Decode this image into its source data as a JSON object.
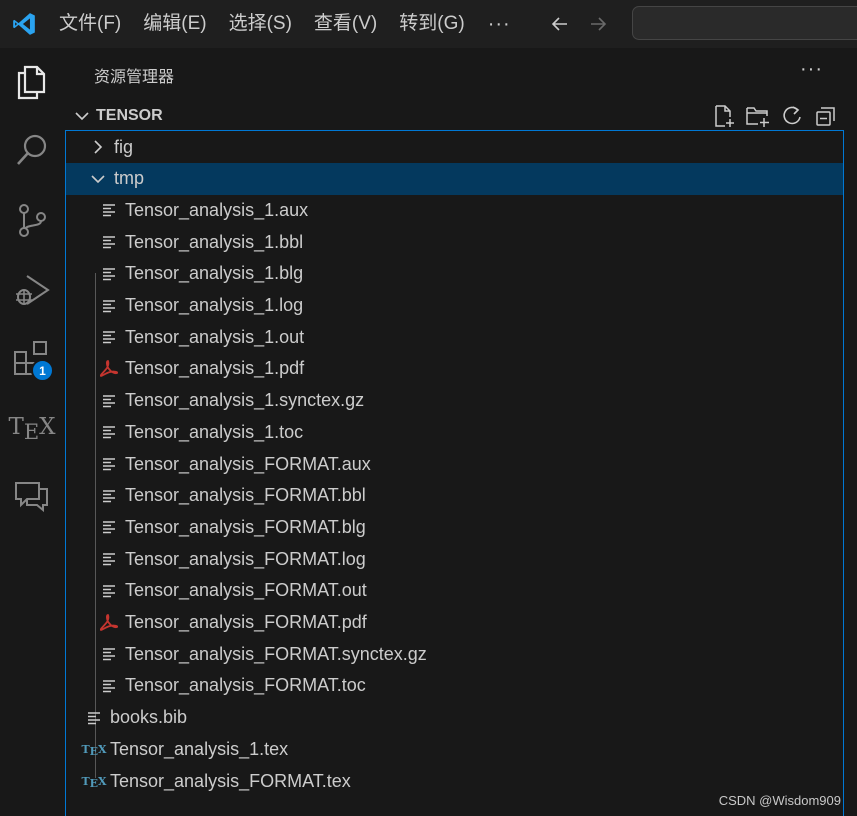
{
  "menu": {
    "items": [
      "文件(F)",
      "编辑(E)",
      "选择(S)",
      "查看(V)",
      "转到(G)"
    ],
    "more": "···"
  },
  "explorer": {
    "title": "资源管理器",
    "more": "···",
    "root": "TENSOR"
  },
  "tree": [
    {
      "name": "fig",
      "type": "folder-collapsed",
      "depth": 0
    },
    {
      "name": "tmp",
      "type": "folder-expanded",
      "depth": 0,
      "selected": true
    },
    {
      "name": "Tensor_analysis_1.aux",
      "type": "text",
      "depth": 1
    },
    {
      "name": "Tensor_analysis_1.bbl",
      "type": "text",
      "depth": 1
    },
    {
      "name": "Tensor_analysis_1.blg",
      "type": "text",
      "depth": 1
    },
    {
      "name": "Tensor_analysis_1.log",
      "type": "text",
      "depth": 1
    },
    {
      "name": "Tensor_analysis_1.out",
      "type": "text",
      "depth": 1
    },
    {
      "name": "Tensor_analysis_1.pdf",
      "type": "pdf",
      "depth": 1
    },
    {
      "name": "Tensor_analysis_1.synctex.gz",
      "type": "text",
      "depth": 1
    },
    {
      "name": "Tensor_analysis_1.toc",
      "type": "text",
      "depth": 1
    },
    {
      "name": "Tensor_analysis_FORMAT.aux",
      "type": "text",
      "depth": 1
    },
    {
      "name": "Tensor_analysis_FORMAT.bbl",
      "type": "text",
      "depth": 1
    },
    {
      "name": "Tensor_analysis_FORMAT.blg",
      "type": "text",
      "depth": 1
    },
    {
      "name": "Tensor_analysis_FORMAT.log",
      "type": "text",
      "depth": 1
    },
    {
      "name": "Tensor_analysis_FORMAT.out",
      "type": "text",
      "depth": 1
    },
    {
      "name": "Tensor_analysis_FORMAT.pdf",
      "type": "pdf",
      "depth": 1
    },
    {
      "name": "Tensor_analysis_FORMAT.synctex.gz",
      "type": "text",
      "depth": 1
    },
    {
      "name": "Tensor_analysis_FORMAT.toc",
      "type": "text",
      "depth": 1
    },
    {
      "name": "books.bib",
      "type": "text",
      "depth": 0
    },
    {
      "name": "Tensor_analysis_1.tex",
      "type": "tex",
      "depth": 0
    },
    {
      "name": "Tensor_analysis_FORMAT.tex",
      "type": "tex",
      "depth": 0
    }
  ],
  "activity": {
    "extensions_badge": "1",
    "tex_label": "TEX"
  },
  "watermark": "CSDN @Wisdom909",
  "colors": {
    "accent": "#0078d4",
    "selection": "#04395e",
    "pdf": "#c5352f",
    "tex": "#519aba"
  }
}
